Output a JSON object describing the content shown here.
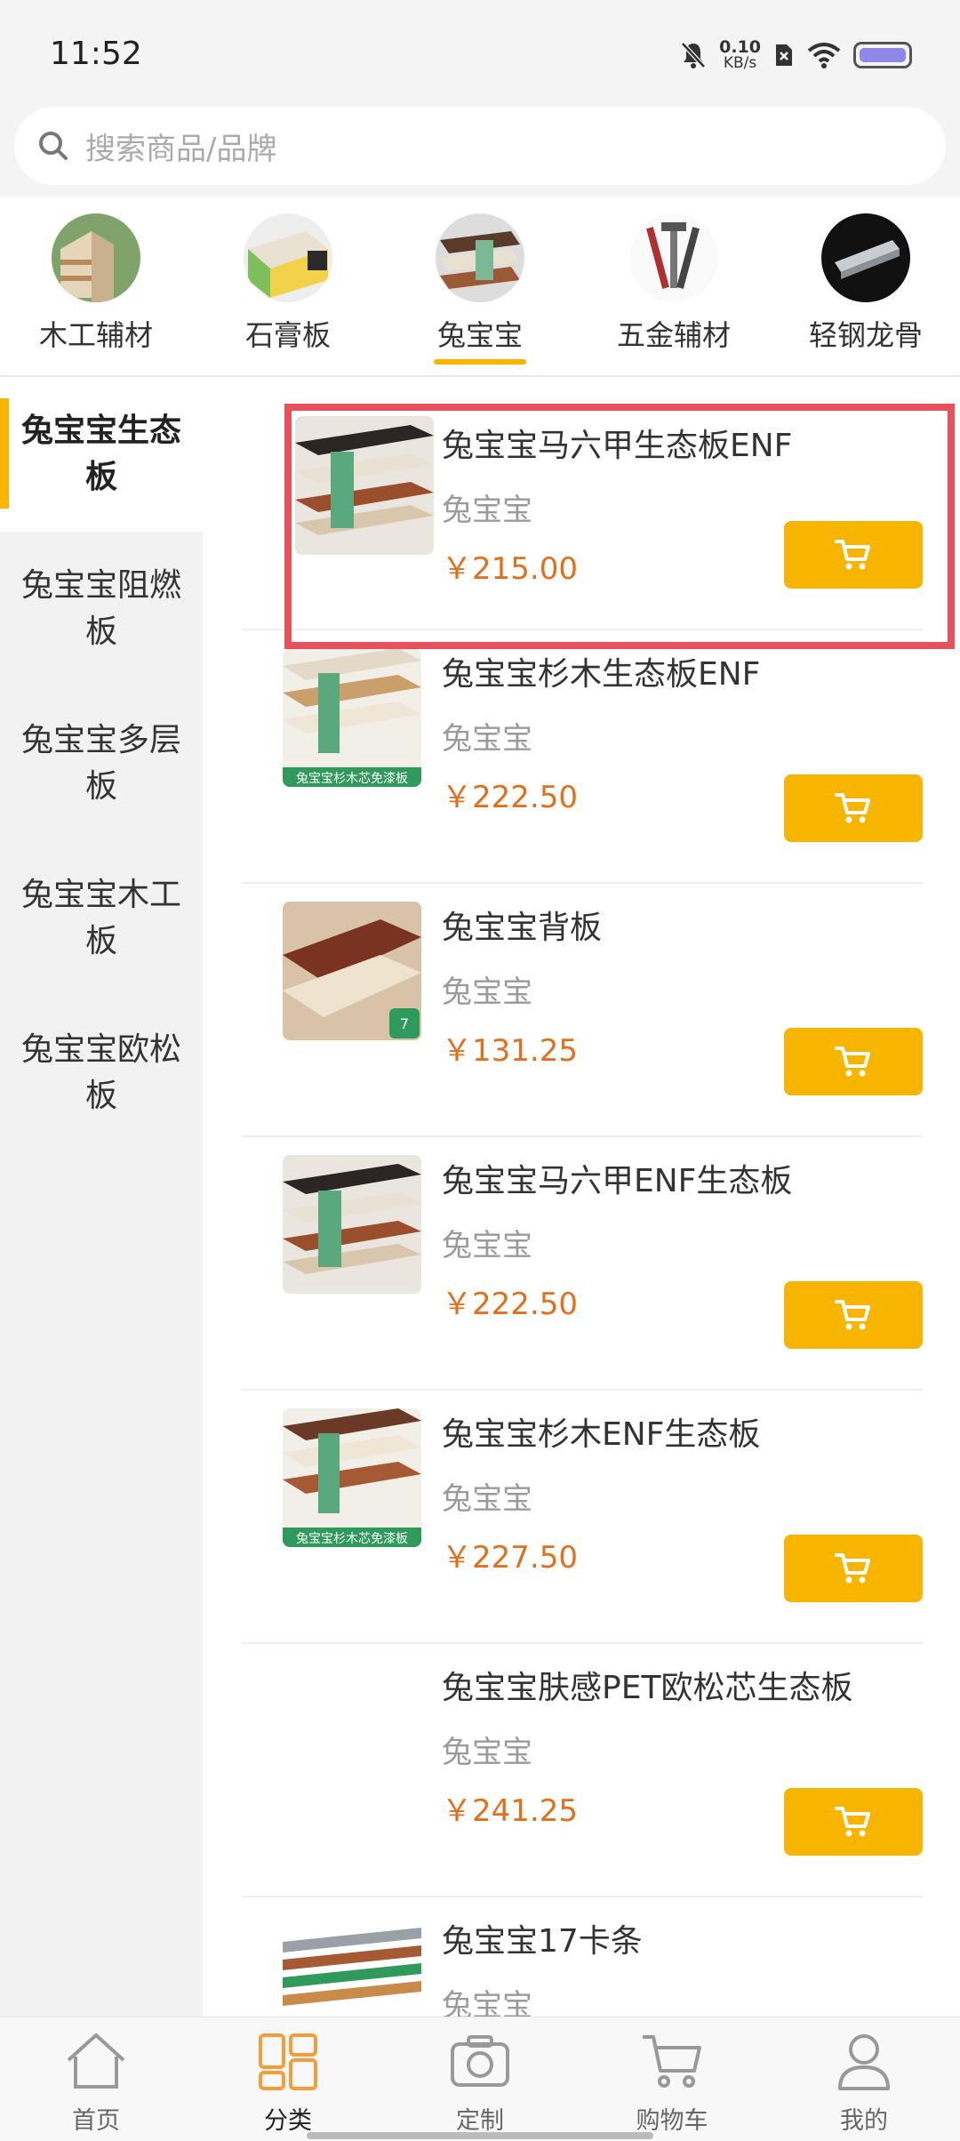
{
  "status_bar": {
    "time": "11:52",
    "net_speed_value": "0.10",
    "net_speed_unit": "KB/s"
  },
  "search": {
    "placeholder": "搜索商品/品牌"
  },
  "categories": [
    {
      "label": "木工辅材"
    },
    {
      "label": "石膏板"
    },
    {
      "label": "兔宝宝",
      "active": true
    },
    {
      "label": "五金辅材"
    },
    {
      "label": "轻钢龙骨"
    }
  ],
  "sidebar": {
    "items": [
      {
        "label": "兔宝宝生态板",
        "active": true
      },
      {
        "label": "兔宝宝阻燃板"
      },
      {
        "label": "兔宝宝多层板"
      },
      {
        "label": "兔宝宝木工板"
      },
      {
        "label": "兔宝宝欧松板"
      }
    ]
  },
  "products": [
    {
      "name": "兔宝宝马六甲生态板ENF",
      "brand": "兔宝宝",
      "price": "￥215.00"
    },
    {
      "name": "兔宝宝杉木生态板ENF",
      "brand": "兔宝宝",
      "price": "￥222.50"
    },
    {
      "name": "兔宝宝背板",
      "brand": "兔宝宝",
      "price": "￥131.25"
    },
    {
      "name": "兔宝宝马六甲ENF生态板",
      "brand": "兔宝宝",
      "price": "￥222.50"
    },
    {
      "name": "兔宝宝杉木ENF生态板",
      "brand": "兔宝宝",
      "price": "￥227.50"
    },
    {
      "name": "兔宝宝肤感PET欧松芯生态板",
      "brand": "兔宝宝",
      "price": "￥241.25"
    },
    {
      "name": "兔宝宝17卡条",
      "brand": "兔宝宝",
      "price": ""
    }
  ],
  "product_image_text": {
    "shan_banner": "兔宝宝杉木芯免漆板",
    "beiban_badge": "7"
  },
  "tabbar": {
    "items": [
      {
        "label": "首页",
        "icon": "home-icon"
      },
      {
        "label": "分类",
        "icon": "category-icon",
        "active": true
      },
      {
        "label": "定制",
        "icon": "camera-icon"
      },
      {
        "label": "购物车",
        "icon": "cart-icon"
      },
      {
        "label": "我的",
        "icon": "user-icon"
      }
    ]
  },
  "colors": {
    "accent": "#f7b500",
    "price": "#e0701c",
    "highlight": "#e8505b"
  }
}
